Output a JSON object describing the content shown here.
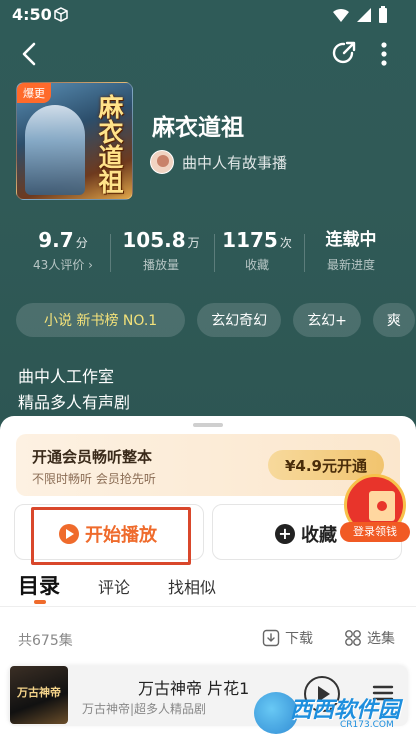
{
  "status": {
    "time": "4:50"
  },
  "book": {
    "cover_badge": "爆更",
    "cover_title": "麻衣道祖",
    "title": "麻衣道祖",
    "author": "曲中人有故事播"
  },
  "stats": [
    {
      "value": "9.7",
      "unit": "分",
      "label": "43人评价 ›"
    },
    {
      "value": "105.8",
      "unit": "万",
      "label": "播放量"
    },
    {
      "value": "1175",
      "unit": "次",
      "label": "收藏"
    },
    {
      "value": "连载中",
      "unit": "",
      "label": "最新进度"
    }
  ],
  "tags": [
    "小说 新书榜 NO.1",
    "玄幻奇幻",
    "玄幻+",
    "爽"
  ],
  "description": [
    "曲中人工作室",
    "精品多人有声剧"
  ],
  "vip": {
    "title": "开通会员畅听整本",
    "subtitle": "不限时畅听 会员抢先听",
    "button": "¥4.9元开通"
  },
  "actions": {
    "play": "开始播放",
    "favorite": "收藏",
    "redpack": "登录领钱"
  },
  "tabs": [
    "目录",
    "评论",
    "找相似"
  ],
  "list": {
    "count": "共675集",
    "download": "下载",
    "select": "选集"
  },
  "mini_player": {
    "cover_text": "万古神帝",
    "title": "万古神帝 片花1",
    "subtitle": "万古神帝|超多人精品剧"
  },
  "watermark": {
    "text": "西西软件园",
    "sub": "CR173.COM"
  },
  "colors": {
    "accent": "#ef6b2c",
    "hero_bg": "#2f5b58",
    "highlight": "#d9472b"
  }
}
